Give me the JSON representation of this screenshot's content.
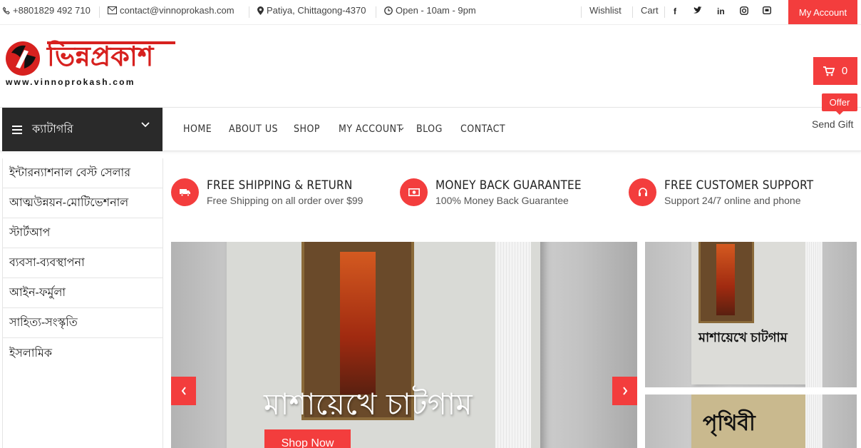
{
  "topbar": {
    "phone": "+8801829 492 710",
    "email": "contact@vinnoprokash.com",
    "address": "Patiya, Chittagong-4370",
    "hours": "Open - 10am - 9pm",
    "wishlist": "Wishlist",
    "cart": "Cart",
    "my_account": "My Account"
  },
  "logo": {
    "brand": "ভিন্নপ্রকাশ",
    "url_text": "www.vinnoprokash.com"
  },
  "cart": {
    "count": "0"
  },
  "nav": {
    "category_label": "ক্যাটাগরি",
    "links": [
      "HOME",
      "ABOUT US",
      "SHOP",
      "MY ACCOUNT",
      "BLOG",
      "CONTACT"
    ],
    "offer_badge": "Offer",
    "send_gift": "Send Gift"
  },
  "categories": [
    "ইন্টারন্যাশনাল বেস্ট সেলার",
    "আত্মউন্নয়ন-মোটিভেশনাল",
    "স্টার্টআপ",
    "ব্যবসা-ব্যবস্থাপনা",
    "আইন-ফর্মুলা",
    "সাহিত্য-সংস্কৃতি",
    "ইসলামিক"
  ],
  "features": [
    {
      "title": "FREE SHIPPING & RETURN",
      "subtitle": "Free Shipping on all order over $99",
      "icon": "truck-icon"
    },
    {
      "title": "MONEY BACK GUARANTEE",
      "subtitle": "100% Money Back Guarantee",
      "icon": "money-icon"
    },
    {
      "title": "FREE CUSTOMER SUPPORT",
      "subtitle": "Support 24/7 online and phone",
      "icon": "headset-icon"
    }
  ],
  "slider": {
    "title": "মাশায়েখে চাটগাম",
    "button": "Shop Now"
  },
  "side_banners": {
    "book1_title": "মাশায়েখে চাটগাম",
    "book2_title": "পৃথিবী"
  },
  "colors": {
    "accent": "#f33d3d",
    "dark": "#2a2a2a"
  }
}
